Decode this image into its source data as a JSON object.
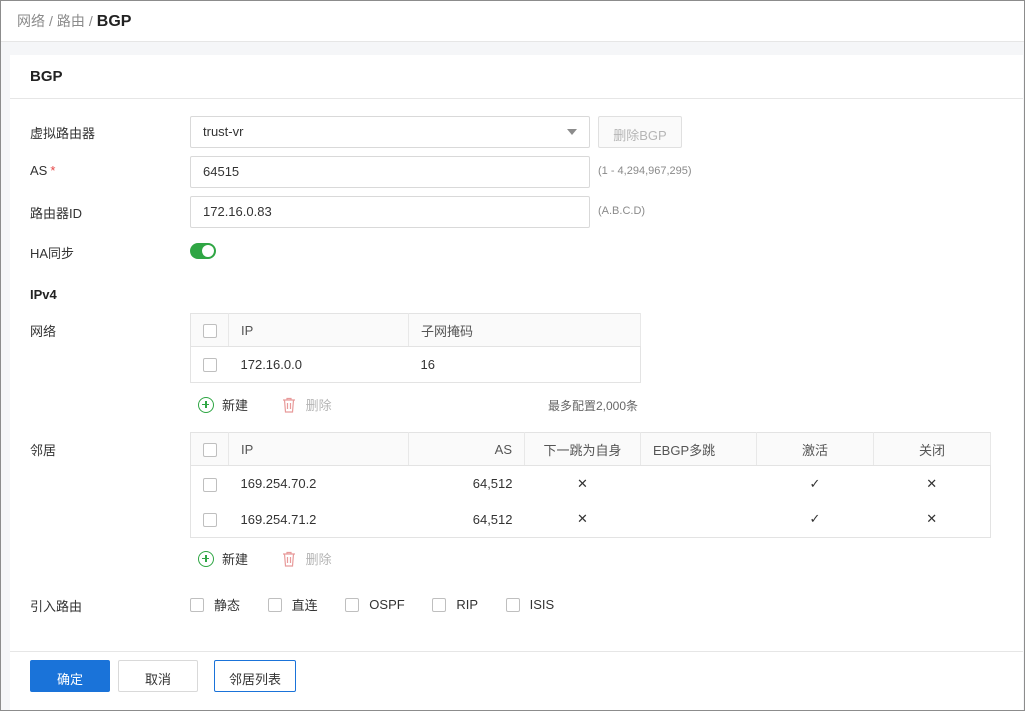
{
  "breadcrumb": {
    "items": [
      "网络",
      "路由"
    ],
    "current": "BGP",
    "separator": "/"
  },
  "panel": {
    "title": "BGP"
  },
  "form": {
    "virtual_router": {
      "label": "虚拟路由器",
      "value": "trust-vr",
      "delete_button": "删除BGP"
    },
    "as": {
      "label": "AS",
      "required_mark": "*",
      "value": "64515",
      "hint": "(1 - 4,294,967,295)"
    },
    "router_id": {
      "label": "路由器ID",
      "value": "172.16.0.83",
      "hint": "(A.B.C.D)"
    },
    "ha_sync": {
      "label": "HA同步",
      "enabled": true
    }
  },
  "ipv4": {
    "title": "IPv4",
    "network": {
      "label": "网络",
      "columns": [
        "IP",
        "子网掩码"
      ],
      "rows": [
        {
          "ip": "172.16.0.0",
          "mask": "16"
        }
      ],
      "add_label": "新建",
      "delete_label": "删除",
      "limit_hint": "最多配置2,000条"
    },
    "neighbors": {
      "label": "邻居",
      "columns": [
        "IP",
        "AS",
        "下一跳为自身",
        "EBGP多跳",
        "激活",
        "关闭"
      ],
      "rows": [
        {
          "ip": "169.254.70.2",
          "as": "64,512",
          "next_hop_self": "✕",
          "ebgp_multihop": "",
          "active": "✓",
          "shutdown": "✕"
        },
        {
          "ip": "169.254.71.2",
          "as": "64,512",
          "next_hop_self": "✕",
          "ebgp_multihop": "",
          "active": "✓",
          "shutdown": "✕"
        }
      ],
      "add_label": "新建",
      "delete_label": "删除"
    }
  },
  "redistribute": {
    "label": "引入路由",
    "options": [
      "静态",
      "直连",
      "OSPF",
      "RIP",
      "ISIS"
    ]
  },
  "footer": {
    "confirm": "确定",
    "cancel": "取消",
    "neighbor_list": "邻居列表"
  },
  "colors": {
    "primary": "#1a73d9",
    "toggle_on": "#2fa644",
    "add_icon": "#2fa644",
    "delete_icon": "#e89a9a"
  }
}
